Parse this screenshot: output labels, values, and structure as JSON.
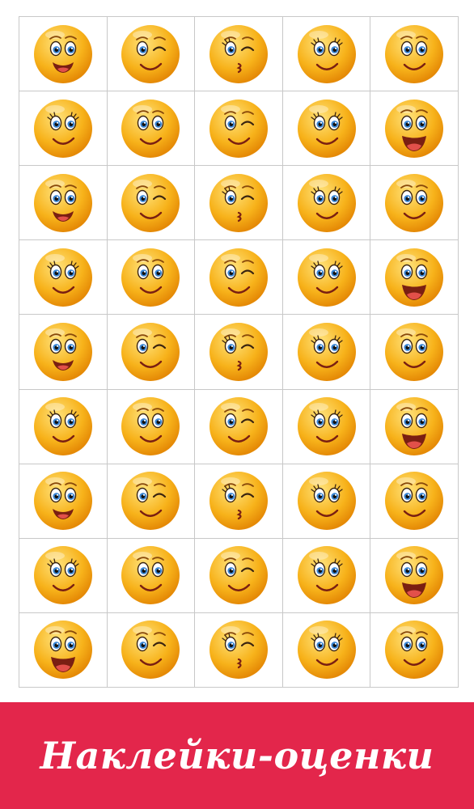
{
  "title": "Наклейки-оценки",
  "colors": {
    "banner": "#e3264b",
    "face": "#f7b21a",
    "face_light": "#ffe27a",
    "face_edge": "#e58a06",
    "iris": "#3a86d4",
    "mouth": "#7a1f12",
    "tongue": "#e2504a",
    "grid_line": "#c8c8c8"
  },
  "stickers": {
    "rows": [
      [
        "happy-smile",
        "winking",
        "flirty-wink",
        "lashes-smile",
        "smile"
      ],
      [
        "lashes-smile",
        "smile",
        "winking",
        "lashes-smile",
        "laughing"
      ],
      [
        "happy-smile",
        "winking",
        "flirty-wink",
        "lashes-smile",
        "smile"
      ],
      [
        "lashes-smile",
        "smile",
        "winking",
        "lashes-smile",
        "laughing"
      ],
      [
        "happy-smile",
        "winking",
        "flirty-wink",
        "lashes-smile",
        "smile"
      ],
      [
        "lashes-smile",
        "smile",
        "winking",
        "lashes-smile",
        "laughing"
      ],
      [
        "happy-smile",
        "winking",
        "flirty-wink",
        "lashes-smile",
        "smile"
      ],
      [
        "lashes-smile",
        "smile",
        "winking",
        "lashes-smile",
        "laughing"
      ],
      [
        "laughing",
        "winking",
        "flirty-wink",
        "lashes-smile",
        "smile"
      ]
    ]
  }
}
